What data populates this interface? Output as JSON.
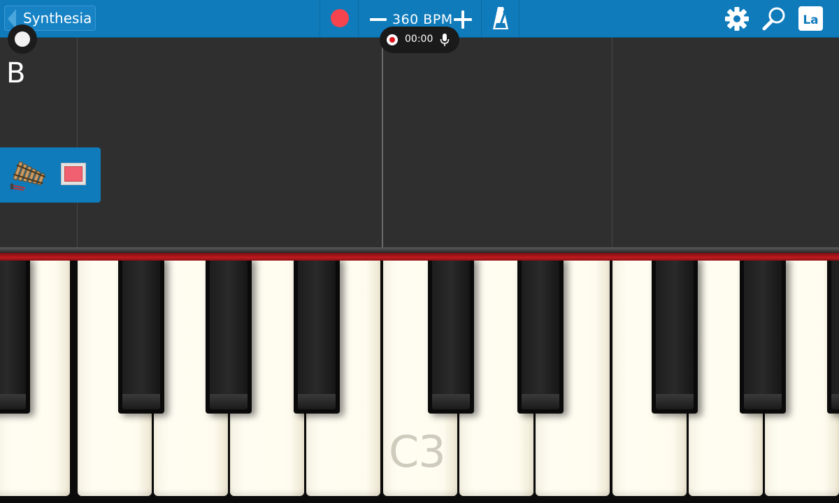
{
  "toolbar": {
    "back_label": "Synthesia",
    "bpm_label": "360 BPM",
    "language_label": "La"
  },
  "recorder": {
    "time": "00:00"
  },
  "note_area": {
    "current_note": "B"
  },
  "keyboard": {
    "marker_label": "C3"
  },
  "colors": {
    "toolbar": "#0f7bbb",
    "record": "#f5444e",
    "felt": "#c01a20",
    "track_color": "#f06070"
  },
  "icons": {
    "record": "record-icon",
    "metronome": "metronome-icon",
    "settings": "gear-icon",
    "search": "search-icon",
    "microphone": "microphone-icon",
    "instrument": "xylophone-icon"
  }
}
